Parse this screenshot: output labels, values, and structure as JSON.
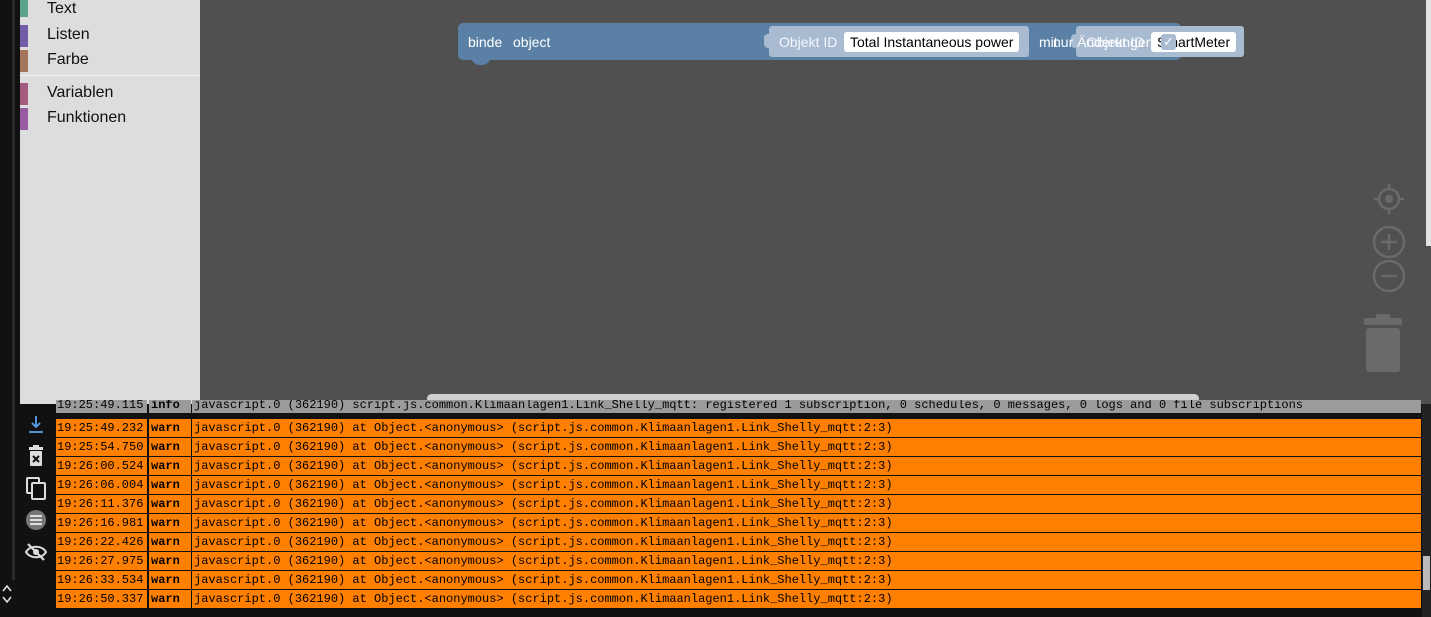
{
  "toolbox": {
    "items": [
      {
        "label": "Text",
        "color": "#5ba58c"
      },
      {
        "label": "Listen",
        "color": "#745ba5"
      },
      {
        "label": "Farbe",
        "color": "#a5745b"
      },
      {
        "label": "Variablen",
        "color": "#a55b80"
      },
      {
        "label": "Funktionen",
        "color": "#995ba5"
      }
    ]
  },
  "block": {
    "binde": "binde",
    "object": "object",
    "obj1_label": "Objekt ID",
    "obj1_value": "Total Instantaneous power",
    "mit": "mit",
    "obj2_label": "Objekt ID",
    "obj2_value": "SmartMeter",
    "nur_aenderungen": "nur Änderungen",
    "checkbox_mark": "✓",
    "checkbox_checked": true
  },
  "log": {
    "rows": [
      {
        "ts": "19:25:49.115",
        "sev": "info",
        "msg": "javascript.0 (362190) script.js.common.Klimaanlagen1.Link_Shelly_mqtt: registered 1 subscription, 0 schedules, 0 messages, 0 logs and 0 file subscriptions"
      },
      {
        "ts": "19:25:49.232",
        "sev": "warn",
        "msg": "javascript.0 (362190) at Object.<anonymous> (script.js.common.Klimaanlagen1.Link_Shelly_mqtt:2:3)"
      },
      {
        "ts": "19:25:54.750",
        "sev": "warn",
        "msg": "javascript.0 (362190) at Object.<anonymous> (script.js.common.Klimaanlagen1.Link_Shelly_mqtt:2:3)"
      },
      {
        "ts": "19:26:00.524",
        "sev": "warn",
        "msg": "javascript.0 (362190) at Object.<anonymous> (script.js.common.Klimaanlagen1.Link_Shelly_mqtt:2:3)"
      },
      {
        "ts": "19:26:06.004",
        "sev": "warn",
        "msg": "javascript.0 (362190) at Object.<anonymous> (script.js.common.Klimaanlagen1.Link_Shelly_mqtt:2:3)"
      },
      {
        "ts": "19:26:11.376",
        "sev": "warn",
        "msg": "javascript.0 (362190) at Object.<anonymous> (script.js.common.Klimaanlagen1.Link_Shelly_mqtt:2:3)"
      },
      {
        "ts": "19:26:16.981",
        "sev": "warn",
        "msg": "javascript.0 (362190) at Object.<anonymous> (script.js.common.Klimaanlagen1.Link_Shelly_mqtt:2:3)"
      },
      {
        "ts": "19:26:22.426",
        "sev": "warn",
        "msg": "javascript.0 (362190) at Object.<anonymous> (script.js.common.Klimaanlagen1.Link_Shelly_mqtt:2:3)"
      },
      {
        "ts": "19:26:27.975",
        "sev": "warn",
        "msg": "javascript.0 (362190) at Object.<anonymous> (script.js.common.Klimaanlagen1.Link_Shelly_mqtt:2:3)"
      },
      {
        "ts": "19:26:33.534",
        "sev": "warn",
        "msg": "javascript.0 (362190) at Object.<anonymous> (script.js.common.Klimaanlagen1.Link_Shelly_mqtt:2:3)"
      },
      {
        "ts": "19:26:50.337",
        "sev": "warn",
        "msg": "javascript.0 (362190) at Object.<anonymous> (script.js.common.Klimaanlagen1.Link_Shelly_mqtt:2:3)"
      }
    ]
  },
  "icons": {
    "log_tools": [
      "scroll-to-bottom-icon",
      "clear-log-icon",
      "copy-log-icon",
      "log-filter-icon",
      "hide-log-icon"
    ],
    "workspace_controls": [
      "recenter-icon",
      "zoom-in-icon",
      "zoom-out-icon",
      "trash-icon"
    ]
  },
  "colors": {
    "warn": "#ff8000",
    "info": "#9b9b9b",
    "block": "#5b80a5",
    "workspace": "#505050"
  }
}
